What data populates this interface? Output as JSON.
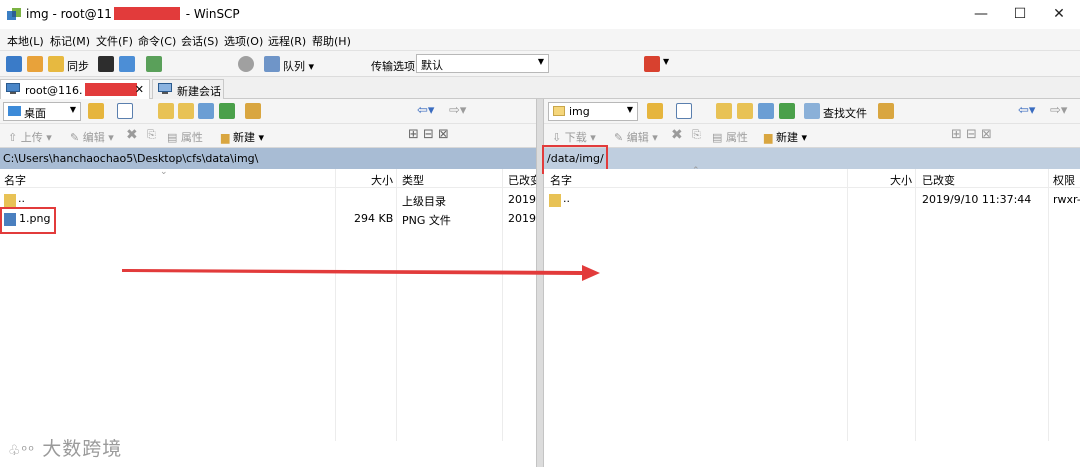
{
  "window": {
    "title_prefix": "img - root@11",
    "title_suffix": " - WinSCP",
    "minimize": "—",
    "maximize": "☐",
    "close": "✕"
  },
  "menu": [
    "本地(L)",
    "标记(M)",
    "文件(F)",
    "命令(C)",
    "会话(S)",
    "选项(O)",
    "远程(R)",
    "帮助(H)"
  ],
  "toolbar": {
    "sync_label": "同步",
    "queue_label": "队列",
    "transfer_label": "传输选项",
    "transfer_value": "默认"
  },
  "tabs": {
    "session_label": "root@116.",
    "session_close": "✕",
    "new_session_label": "新建会话"
  },
  "left": {
    "location": "桌面",
    "upload_label": "上传",
    "edit_label": "编辑",
    "props_label": "属性",
    "new_label": "新建",
    "path": "C:\\Users\\hanchaochao5\\Desktop\\cfs\\data\\img\\",
    "columns": {
      "name": "名字",
      "size": "大小",
      "type": "类型",
      "modified": "已改变"
    },
    "rows": [
      {
        "name": "..",
        "size": "",
        "type": "上级目录",
        "modified": "2019/"
      },
      {
        "name": "1.png",
        "size": "294 KB",
        "type": "PNG 文件",
        "modified": "2019/"
      }
    ]
  },
  "right": {
    "location": "img",
    "find_label": "查找文件",
    "download_label": "下载",
    "edit_label": "编辑",
    "props_label": "属性",
    "new_label": "新建",
    "path": "/data/img/",
    "columns": {
      "name": "名字",
      "size": "大小",
      "modified": "已改变",
      "rights": "权限"
    },
    "rows": [
      {
        "name": "..",
        "size": "",
        "modified": "2019/9/10 11:37:44",
        "rights": "rwxr-"
      }
    ]
  },
  "watermark": "大数跨境",
  "colors": {
    "highlight": "#e23b3b",
    "left_path_bg": "#a8bcd4",
    "right_path_bg": "#bfcedf",
    "arrow": "#e23b3b"
  },
  "icons": {
    "app": "winscp-icon",
    "folder": "folder-icon",
    "png_file": "image-file-icon",
    "parent_dir": "parent-folder-icon"
  }
}
